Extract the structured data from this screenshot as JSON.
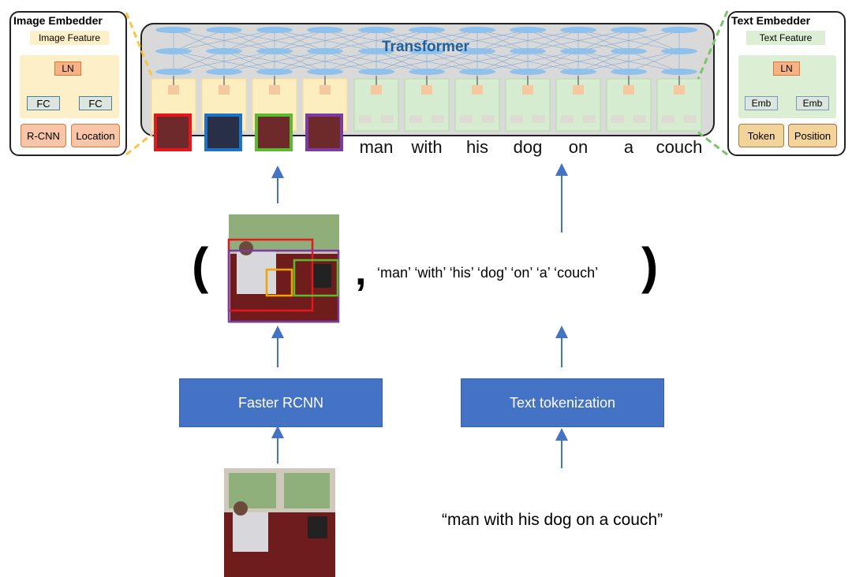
{
  "image_embedder": {
    "title": "Image Embedder",
    "feature": "Image Feature",
    "ln": "LN",
    "fc1": "FC",
    "fc2": "FC",
    "in1": "R-CNN",
    "in2": "Location"
  },
  "text_embedder": {
    "title": "Text Embedder",
    "feature": "Text Feature",
    "ln": "LN",
    "emb1": "Emb",
    "emb2": "Emb",
    "in1": "Token",
    "in2": "Position"
  },
  "transformer": {
    "title": "Transformer"
  },
  "region_border_colors": [
    "#e8161b",
    "#1a73c9",
    "#5cba2e",
    "#7b3aa6"
  ],
  "words": [
    "man",
    "with",
    "his",
    "dog",
    "on",
    "a",
    "couch"
  ],
  "tokens_text": "‘man’ ‘with’ ‘his’ ‘dog’ ‘on’ ‘a’ ‘couch’",
  "paren_open": "(",
  "paren_close": ")",
  "comma": ",",
  "faster_rcnn": "Faster RCNN",
  "text_tokenization": "Text tokenization",
  "caption": "“man with his dog on a couch”",
  "colors": {
    "arrow": "#4472c4",
    "box": "#4472c4",
    "transformer_bg": "#d9d9d9"
  }
}
